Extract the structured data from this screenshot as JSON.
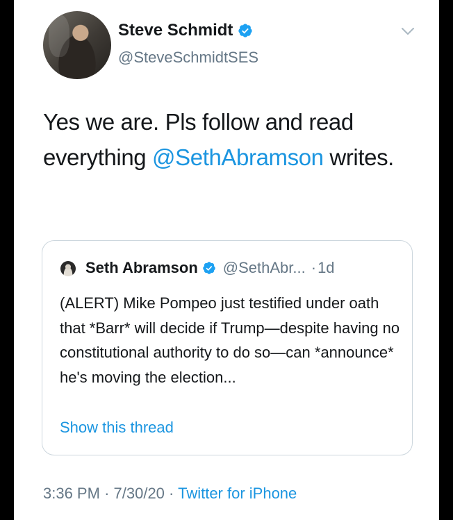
{
  "tweet": {
    "author": {
      "display_name": "Steve Schmidt",
      "handle": "@SteveSchmidtSES",
      "verified": true
    },
    "text_parts": {
      "before_mention": "Yes we are. Pls follow and read everything ",
      "mention": "@SethAbramson",
      "after_mention": " writes."
    },
    "quoted": {
      "display_name": "Seth Abramson",
      "handle": "@SethAbr...",
      "separator": "·",
      "age": "1d",
      "verified": true,
      "text": "(ALERT) Mike Pompeo just testified under oath that *Barr* will decide if Trump—despite having no constitutional authority to do so—can *announce* he's moving the election...",
      "show_thread": "Show this thread"
    },
    "meta": {
      "time": "3:36 PM",
      "sep1": "·",
      "date": "7/30/20",
      "sep2": "·",
      "source": "Twitter for iPhone"
    }
  },
  "colors": {
    "link": "#1b95e0",
    "secondary_text": "#657786",
    "primary_text": "#14171a",
    "border": "#ccd6dd",
    "background": "#000000"
  },
  "icons": [
    "verified-badge-icon",
    "chevron-down-icon"
  ]
}
